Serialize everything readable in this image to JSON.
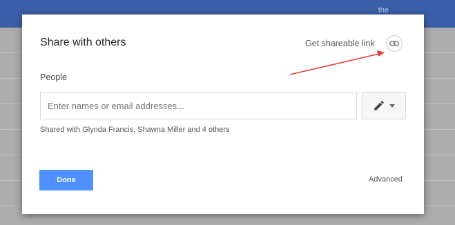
{
  "background": {
    "header_label": "the"
  },
  "dialog": {
    "title": "Share with others",
    "get_link_label": "Get shareable link",
    "get_link_icon": "link-icon",
    "people_label": "People",
    "people_input": {
      "placeholder": "Enter names or email addresses...",
      "value": ""
    },
    "permission_icon": "pencil-icon",
    "permission_dropdown_icon": "caret-down-icon",
    "shared_with": "Shared with Glynda Francis, Shawna Miller and 4 others",
    "done_label": "Done",
    "advanced_label": "Advanced"
  },
  "colors": {
    "header": "#3b5fa8",
    "primary_button": "#4d90fe",
    "annotation_arrow": "#e53935"
  }
}
